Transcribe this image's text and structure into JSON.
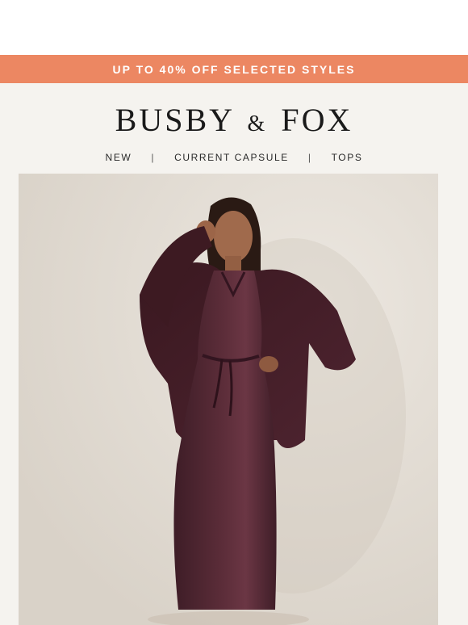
{
  "promo": {
    "text": "UP TO 40% OFF SELECTED STYLES",
    "bg_color": "#ec8762"
  },
  "brand": {
    "part1": "BUSBY",
    "amp": "&",
    "part2": "FOX"
  },
  "nav": {
    "items": [
      {
        "label": "NEW"
      },
      {
        "label": "CURRENT CAPSULE"
      },
      {
        "label": "TOPS"
      }
    ],
    "separator": "|"
  },
  "hero": {
    "icon": "model-photo",
    "colors": {
      "garment": "#4a2430",
      "wall": "#e6e0d8"
    }
  }
}
